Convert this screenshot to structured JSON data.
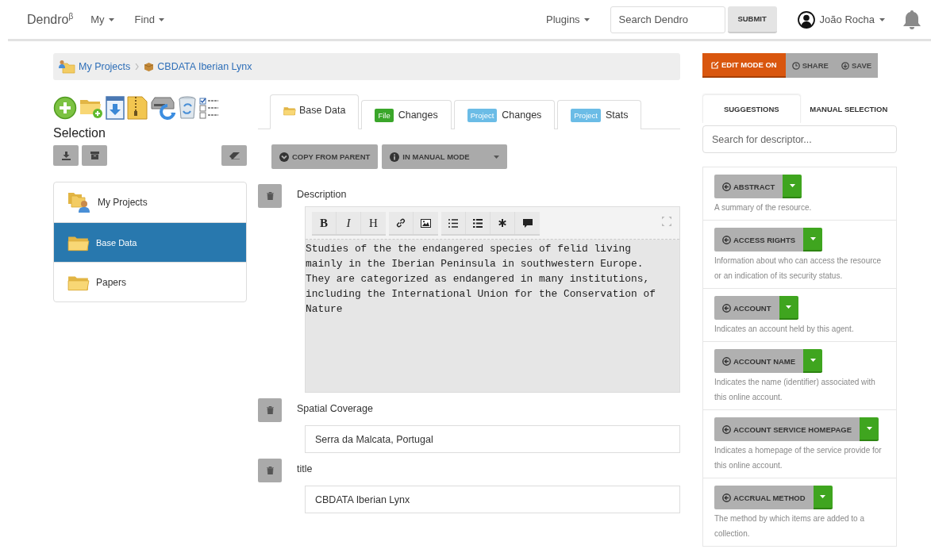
{
  "navbar": {
    "brand": "Dendro$^{β}$",
    "menus": [
      {
        "label": "My"
      },
      {
        "label": "Find"
      }
    ],
    "plugins": "Plugins",
    "search": {
      "placeholder": "Search Dendro"
    },
    "submit": "SUBMIT",
    "user": "João Rocha"
  },
  "breadcrumb": [
    {
      "label": "My Projects",
      "kind": "projects"
    },
    {
      "label": "CBDATA Iberian Lynx",
      "kind": "project"
    }
  ],
  "selection": {
    "title": "Selection"
  },
  "folders": [
    {
      "label": "My Projects",
      "kind": "projects",
      "selected": false
    },
    {
      "label": "Base Data",
      "kind": "folder",
      "selected": true
    },
    {
      "label": "Papers",
      "kind": "folder",
      "selected": false
    }
  ],
  "tabs": [
    {
      "label": "Base Data",
      "kind": "folder",
      "selected": true
    },
    {
      "label": "Changes",
      "kind": "badge",
      "badge": "File",
      "color": "#3aa62a",
      "selected": false
    },
    {
      "label": "Changes",
      "kind": "badge",
      "badge": "Project",
      "color": "#6bbce6",
      "selected": false
    },
    {
      "label": "Stats",
      "kind": "badge",
      "badge": "Project",
      "color": "#6bbce6",
      "selected": false
    }
  ],
  "actions": [
    {
      "label": "COPY FROM PARENT",
      "kind": "copy"
    },
    {
      "label": "IN MANUAL MODE",
      "kind": "dropdown"
    }
  ],
  "editor_toolbar": [
    [
      {
        "kind": "bold",
        "label": "B"
      },
      {
        "kind": "italic",
        "label": "I"
      },
      {
        "kind": "heading",
        "label": "H"
      }
    ],
    [
      {
        "kind": "link"
      },
      {
        "kind": "image"
      }
    ],
    [
      {
        "kind": "ordered-list"
      },
      {
        "kind": "bullet-list"
      },
      {
        "kind": "asterisk"
      },
      {
        "kind": "comment"
      }
    ]
  ],
  "fields": [
    {
      "label": "Description",
      "kind": "rich-text",
      "value": "Studies of the the endangered species of felid living\nmainly in the Iberian Peninsula in southwestern Europe.\nThey are categorized as endangered in many institutions,\nincluding the International Union for the Conservation of\nNature"
    },
    {
      "label": "Spatial Coverage",
      "kind": "text",
      "value": "Serra da Malcata, Portugal"
    },
    {
      "label": "title",
      "kind": "text",
      "value": "CBDATA Iberian Lynx"
    }
  ],
  "mode_buttons": [
    {
      "label": "EDIT MODE ON",
      "kind": "edit",
      "active": true
    },
    {
      "label": "SHARE",
      "kind": "share",
      "active": false
    },
    {
      "label": "SAVE",
      "kind": "save",
      "active": false
    }
  ],
  "descriptor_tabs": [
    {
      "label": "SUGGESTIONS",
      "selected": true
    },
    {
      "label": "MANUAL SELECTION",
      "selected": false
    }
  ],
  "descriptor_search": {
    "placeholder": "Search for descriptor..."
  },
  "descriptors": [
    {
      "name": "ABSTRACT",
      "description": "A summary of the resource."
    },
    {
      "name": "ACCESS RIGHTS",
      "description": "Information about who can access the resource or an indication of its security status."
    },
    {
      "name": "ACCOUNT",
      "description": "Indicates an account held by this agent."
    },
    {
      "name": "ACCOUNT NAME",
      "description": "Indicates the name (identifier) associated with this online account."
    },
    {
      "name": "ACCOUNT SERVICE HOMEPAGE",
      "description": "Indicates a homepage of the service provide for this online account."
    },
    {
      "name": "ACCRUAL METHOD",
      "description": "The method by which items are added to a collection."
    }
  ]
}
